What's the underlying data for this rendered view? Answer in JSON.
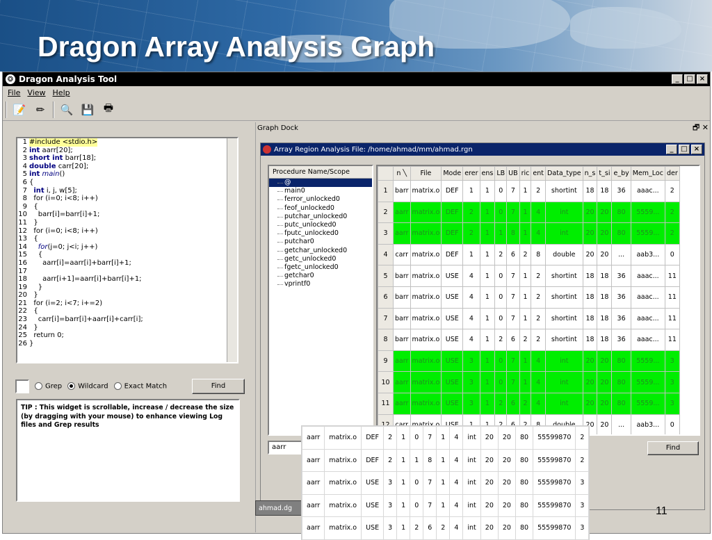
{
  "slide": {
    "title": "Dragon Array Analysis Graph",
    "page_number": "11"
  },
  "window": {
    "title": "Dragon Analysis Tool",
    "icon": "dragon-icon",
    "controls": [
      "_",
      "□",
      "×"
    ]
  },
  "menu": [
    "File",
    "View",
    "Help"
  ],
  "toolbar": [
    "edit-icon",
    "pencil-icon",
    "search-icon",
    "save-icon",
    "print-icon"
  ],
  "code_lines": [
    {
      "n": "1",
      "html": "#include &lt;stdio.h&gt;",
      "hl": true
    },
    {
      "n": "2",
      "html": "<span class='kw'>int</span> aarr[20];"
    },
    {
      "n": "3",
      "html": "<span class='kw'>short int</span> barr[18];"
    },
    {
      "n": "4",
      "html": "<span class='kw'>double</span> carr[20];"
    },
    {
      "n": "5",
      "html": "<span class='kw'>int</span> <span class='it'>main</span>()"
    },
    {
      "n": "6",
      "html": "{"
    },
    {
      "n": "7",
      "html": "&nbsp;&nbsp;<span class='kw'>int</span> i, j, w[5];"
    },
    {
      "n": "8",
      "html": "&nbsp;&nbsp;for (i=0; i&lt;8; i++)"
    },
    {
      "n": "9",
      "html": "&nbsp;&nbsp;{"
    },
    {
      "n": "10",
      "html": "&nbsp;&nbsp;&nbsp;&nbsp;barr[i]=barr[i]+1;"
    },
    {
      "n": "11",
      "html": "&nbsp;&nbsp;}"
    },
    {
      "n": "12",
      "html": "&nbsp;&nbsp;for (i=0; i&lt;8; i++)"
    },
    {
      "n": "13",
      "html": "&nbsp;&nbsp;{"
    },
    {
      "n": "14",
      "html": "&nbsp;&nbsp;&nbsp;&nbsp;<span class='it'>for</span>(j=0; j&lt;i; j++)"
    },
    {
      "n": "15",
      "html": "&nbsp;&nbsp;&nbsp;&nbsp;{"
    },
    {
      "n": "16",
      "html": "&nbsp;&nbsp;&nbsp;&nbsp;&nbsp;&nbsp;aarr[i]=aarr[i]+barr[i]+1;"
    },
    {
      "n": "17",
      "html": ""
    },
    {
      "n": "18",
      "html": "&nbsp;&nbsp;&nbsp;&nbsp;&nbsp;&nbsp;aarr[i+1]=aarr[i]+barr[i]+1;"
    },
    {
      "n": "19",
      "html": "&nbsp;&nbsp;&nbsp;&nbsp;}"
    },
    {
      "n": "20",
      "html": "&nbsp;&nbsp;}"
    },
    {
      "n": "21",
      "html": "&nbsp;&nbsp;for (i=2; i&lt;7; i+=2)"
    },
    {
      "n": "22",
      "html": "&nbsp;&nbsp;{"
    },
    {
      "n": "23",
      "html": "&nbsp;&nbsp;&nbsp;&nbsp;carr[i]=barr[i]+aarr[i]+carr[i];"
    },
    {
      "n": "24",
      "html": "&nbsp;&nbsp;}"
    },
    {
      "n": "25",
      "html": "&nbsp;&nbsp;return 0;"
    },
    {
      "n": "26",
      "html": "}"
    }
  ],
  "search": {
    "grep": "Grep",
    "wildcard": "Wildcard",
    "exact": "Exact Match",
    "find": "Find",
    "selected": "Wildcard"
  },
  "tip": "TIP : This widget is scrollable, increase / decrease the size (by dragging with your mouse) to enhance viewing Log files and Grep results",
  "dock": {
    "title": "Graph Dock",
    "controls": "🗗 ✕"
  },
  "inner_window": {
    "title": "Array Region Analysis File: /home/ahmad/mm/ahmad.rgn"
  },
  "procedures": {
    "header": "Procedure Name/Scope",
    "items": [
      "@",
      "main0",
      "ferror_unlocked0",
      "feof_unlocked0",
      "putchar_unlocked0",
      "putc_unlocked0",
      "fputc_unlocked0",
      "putchar0",
      "getchar_unlocked0",
      "getc_unlocked0",
      "fgetc_unlocked0",
      "getchar0",
      "vprintf0"
    ],
    "selected": 0
  },
  "grid": {
    "columns": [
      "n ╲",
      "File",
      "Mode",
      "erer",
      "ens",
      "LB",
      "UB",
      "ric",
      "ent",
      "Data_type",
      "n_s",
      "t_si",
      "e_by",
      "Mem_Loc",
      "der"
    ],
    "rows": [
      {
        "n": "1",
        "green": false,
        "cells": [
          "barr",
          "matrix.o",
          "DEF",
          "1",
          "1",
          "0",
          "7",
          "1",
          "2",
          "shortint",
          "18",
          "18",
          "36",
          "aaac...",
          "2"
        ]
      },
      {
        "n": "2",
        "green": true,
        "cells": [
          "aarr",
          "matrix.o",
          "DEF",
          "2",
          "1",
          "0",
          "7",
          "1",
          "4",
          "int",
          "20",
          "20",
          "80",
          "5559...",
          "2"
        ]
      },
      {
        "n": "3",
        "green": true,
        "cells": [
          "aarr",
          "matrix.o",
          "DEF",
          "2",
          "1",
          "1",
          "8",
          "1",
          "4",
          "int",
          "20",
          "20",
          "80",
          "5559...",
          "2"
        ]
      },
      {
        "n": "4",
        "green": false,
        "cells": [
          "carr",
          "matrix.o",
          "DEF",
          "1",
          "1",
          "2",
          "6",
          "2",
          "8",
          "double",
          "20",
          "20",
          "...",
          "aab3...",
          "0"
        ]
      },
      {
        "n": "5",
        "green": false,
        "cells": [
          "barr",
          "matrix.o",
          "USE",
          "4",
          "1",
          "0",
          "7",
          "1",
          "2",
          "shortint",
          "18",
          "18",
          "36",
          "aaac...",
          "11"
        ]
      },
      {
        "n": "6",
        "green": false,
        "cells": [
          "barr",
          "matrix.o",
          "USE",
          "4",
          "1",
          "0",
          "7",
          "1",
          "2",
          "shortint",
          "18",
          "18",
          "36",
          "aaac...",
          "11"
        ]
      },
      {
        "n": "7",
        "green": false,
        "cells": [
          "barr",
          "matrix.o",
          "USE",
          "4",
          "1",
          "0",
          "7",
          "1",
          "2",
          "shortint",
          "18",
          "18",
          "36",
          "aaac...",
          "11"
        ]
      },
      {
        "n": "8",
        "green": false,
        "cells": [
          "barr",
          "matrix.o",
          "USE",
          "4",
          "1",
          "2",
          "6",
          "2",
          "2",
          "shortint",
          "18",
          "18",
          "36",
          "aaac...",
          "11"
        ]
      },
      {
        "n": "9",
        "green": true,
        "cells": [
          "aarr",
          "matrix.o",
          "USE",
          "3",
          "1",
          "0",
          "7",
          "1",
          "4",
          "int",
          "20",
          "20",
          "80",
          "5559...",
          "3"
        ]
      },
      {
        "n": "10",
        "green": true,
        "cells": [
          "aarr",
          "matrix.o",
          "USE",
          "3",
          "1",
          "0",
          "7",
          "1",
          "4",
          "int",
          "20",
          "20",
          "80",
          "5559...",
          "3"
        ]
      },
      {
        "n": "11",
        "green": true,
        "cells": [
          "aarr",
          "matrix.o",
          "USE",
          "3",
          "1",
          "2",
          "6",
          "2",
          "4",
          "int",
          "20",
          "20",
          "80",
          "5559...",
          "3"
        ]
      },
      {
        "n": "12",
        "green": false,
        "cells": [
          "carr",
          "matrix.o",
          "USE",
          "1",
          "1",
          "2",
          "6",
          "2",
          "8",
          "double",
          "20",
          "20",
          "...",
          "aab3...",
          "0"
        ]
      }
    ]
  },
  "proc_input": "aarr",
  "find2": "Find",
  "task_button": "ahmad.dg",
  "overlay_rows": [
    [
      "aarr",
      "matrix.o",
      "DEF",
      "2",
      "1",
      "0",
      "7",
      "1",
      "4",
      "int",
      "20",
      "20",
      "80",
      "55599870",
      "2"
    ],
    [
      "aarr",
      "matrix.o",
      "DEF",
      "2",
      "1",
      "1",
      "8",
      "1",
      "4",
      "int",
      "20",
      "20",
      "80",
      "55599870",
      "2"
    ],
    [
      "aarr",
      "matrix.o",
      "USE",
      "3",
      "1",
      "0",
      "7",
      "1",
      "4",
      "int",
      "20",
      "20",
      "80",
      "55599870",
      "3"
    ],
    [
      "aarr",
      "matrix.o",
      "USE",
      "3",
      "1",
      "0",
      "7",
      "1",
      "4",
      "int",
      "20",
      "20",
      "80",
      "55599870",
      "3"
    ],
    [
      "aarr",
      "matrix.o",
      "USE",
      "3",
      "1",
      "2",
      "6",
      "2",
      "4",
      "int",
      "20",
      "20",
      "80",
      "55599870",
      "3"
    ]
  ]
}
